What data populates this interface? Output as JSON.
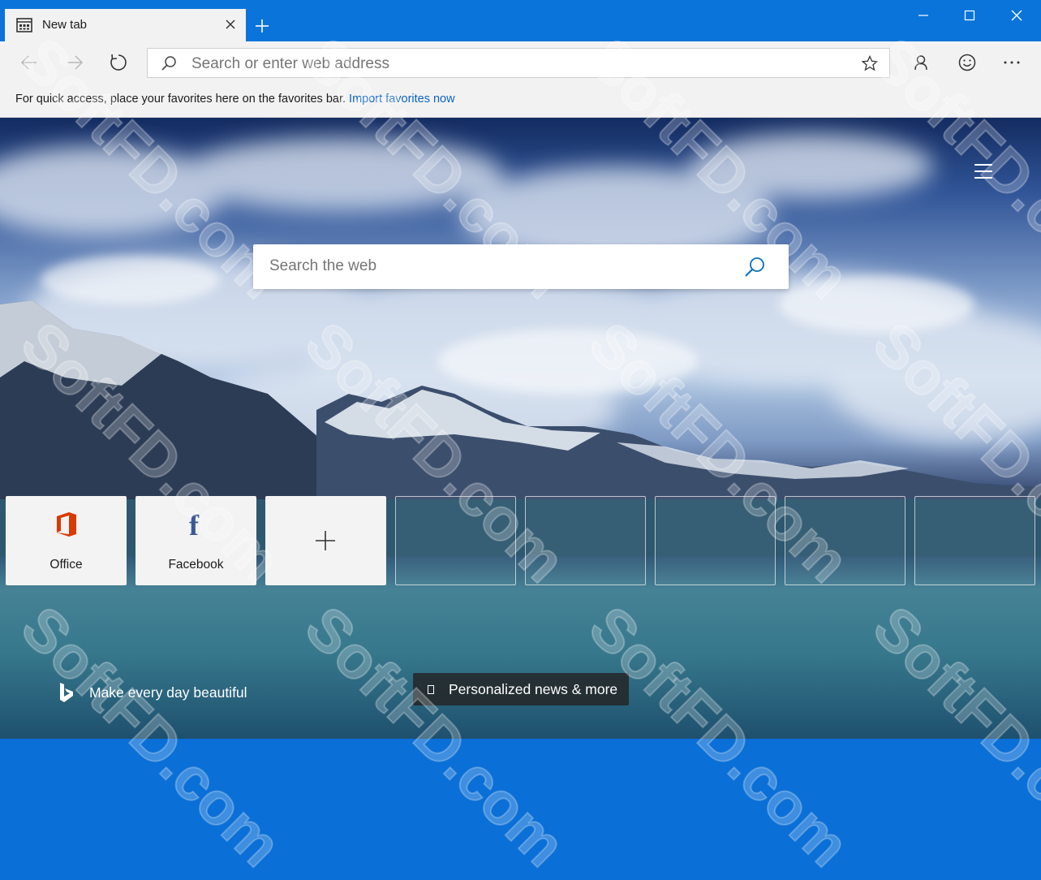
{
  "tab": {
    "title": "New tab"
  },
  "address_bar": {
    "placeholder": "Search or enter web address"
  },
  "favorites_bar": {
    "message": "For quick access, place your favorites here on the favorites bar.",
    "link": "Import favorites now"
  },
  "new_tab_page": {
    "search": {
      "placeholder": "Search the web"
    },
    "tiles": [
      {
        "label": "Office",
        "icon": "office-icon"
      },
      {
        "label": "Facebook",
        "icon": "facebook-icon"
      },
      {
        "label": "",
        "icon": "plus-icon"
      }
    ],
    "bing_tagline": "Make every day beautiful",
    "news_button": "Personalized news & more"
  },
  "watermark": "SoftFD.com",
  "colors": {
    "titlebar": "#0a74da",
    "toolbar": "#f2f2f2",
    "link": "#0b63c4",
    "office_orange": "#d83b01",
    "facebook_blue": "#3b5998",
    "search_icon_blue": "#0a6fbd"
  }
}
